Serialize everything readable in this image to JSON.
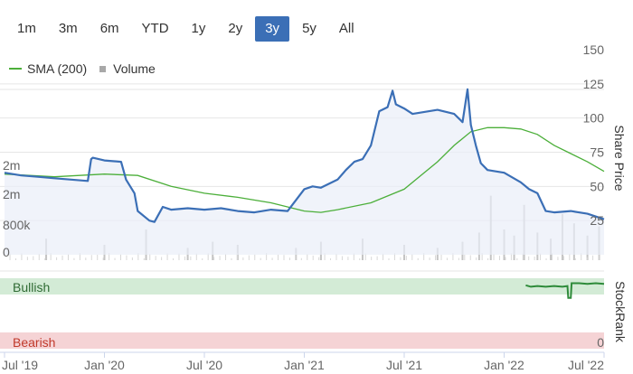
{
  "range_selector": {
    "buttons": [
      "1m",
      "3m",
      "6m",
      "YTD",
      "1y",
      "2y",
      "3y",
      "5y",
      "All"
    ],
    "active": "3y"
  },
  "legend": {
    "sma_label": "SMA (200)",
    "volume_label": "Volume"
  },
  "colors": {
    "price": "#3b6fb6",
    "sma": "#4caf3a",
    "volume": "#c4c4c4",
    "bullish": "#d3ebd6",
    "bearish": "#f5d3d5",
    "stockrank": "#2e8b3a",
    "active_button": "#3b6fb6"
  },
  "chart_data": [
    {
      "type": "line",
      "ylabel": "Share Price",
      "ylim": [
        0,
        150
      ],
      "y_ticks": [
        "150",
        "125",
        "100",
        "75",
        "50",
        "25"
      ],
      "volume_ticks": [
        "2m",
        "2m",
        "800k",
        "0"
      ],
      "x_ticks": [
        "Jul '19",
        "Jan '20",
        "Jul '20",
        "Jan '21",
        "Jul '21",
        "Jan '22",
        "Jul '22"
      ],
      "x_tick_months": [
        0,
        6,
        12,
        18,
        24,
        30,
        36
      ],
      "series": [
        {
          "name": "SMA (200)",
          "x_month": [
            0,
            3,
            6,
            8,
            10,
            12,
            14,
            16,
            18,
            19,
            20,
            22,
            24,
            25,
            26,
            27,
            28,
            29,
            30,
            31,
            32,
            33,
            34,
            35,
            36
          ],
          "values": [
            59,
            57,
            59,
            58,
            50,
            45,
            42,
            38,
            32,
            31,
            33,
            38,
            48,
            58,
            68,
            80,
            90,
            93,
            93,
            92,
            88,
            80,
            74,
            68,
            61
          ]
        },
        {
          "name": "Share Price",
          "x_month": [
            0,
            1,
            2,
            3,
            4,
            5,
            5.2,
            5.3,
            6,
            7,
            7.3,
            7.8,
            8,
            8.7,
            9,
            9.5,
            10,
            11,
            12,
            13,
            14,
            15,
            16,
            17,
            18,
            18.5,
            19,
            19.5,
            20,
            20.5,
            21,
            21.5,
            22,
            22.5,
            23,
            23.3,
            23.5,
            24,
            24.5,
            25,
            26,
            27,
            27.5,
            27.8,
            28,
            28.3,
            28.6,
            29,
            30,
            31,
            31.5,
            32,
            32.5,
            33,
            34,
            35,
            36
          ],
          "values": [
            60,
            58,
            57,
            56,
            55,
            54,
            70,
            71,
            69,
            68,
            55,
            45,
            32,
            25,
            24,
            35,
            33,
            34,
            33,
            34,
            32,
            31,
            33,
            32,
            48,
            50,
            49,
            52,
            55,
            62,
            68,
            70,
            80,
            105,
            108,
            120,
            110,
            107,
            103,
            104,
            106,
            103,
            97,
            121,
            95,
            80,
            67,
            62,
            60,
            53,
            48,
            45,
            32,
            31,
            32,
            30,
            26
          ]
        }
      ],
      "volume_bars": {
        "x_month": [
          2.5,
          6,
          8.5,
          11,
          12.5,
          14,
          17.5,
          19,
          21.5,
          24,
          26,
          27.5,
          28.5,
          29.2,
          30,
          30.6,
          31.2,
          32,
          32.8,
          33.5,
          34.2,
          35,
          35.7
        ],
        "values": [
          0.7,
          0.5,
          1.0,
          0.4,
          0.6,
          0.5,
          0.4,
          0.6,
          0.7,
          0.5,
          0.4,
          0.6,
          0.9,
          2.1,
          1.0,
          0.8,
          1.8,
          0.9,
          0.7,
          1.5,
          1.2,
          0.8,
          1.1
        ]
      }
    },
    {
      "type": "line",
      "ylabel": "StockRank",
      "ylim": [
        0,
        100
      ],
      "band_top_label": "Bullish",
      "band_bottom_label": "Bearish",
      "band_bottom_value": "0",
      "series": [
        {
          "name": "StockRank",
          "x_month": [
            31.3,
            31.6,
            32,
            32.5,
            33,
            33.5,
            33.8,
            33.85,
            34,
            34.05,
            34.5,
            35,
            35.5,
            36
          ],
          "values": [
            90,
            88,
            89,
            88,
            89,
            88,
            89,
            72,
            72,
            93,
            93,
            92,
            93,
            92
          ]
        }
      ]
    }
  ]
}
